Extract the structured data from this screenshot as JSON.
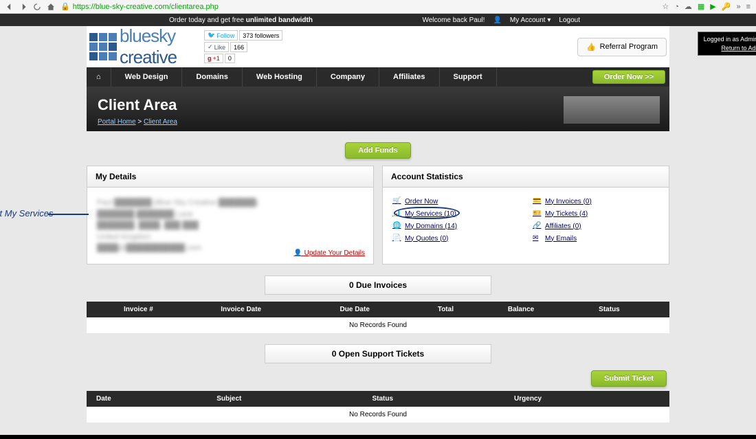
{
  "browser": {
    "url": "https://blue-sky-creative.com/clientarea.php"
  },
  "announce": {
    "left_pre": "Order today and get free ",
    "left_bold": "unlimited bandwidth",
    "welcome": "Welcome back Paul!",
    "my_account": "My Account",
    "logout": "Logout"
  },
  "admin_badge": {
    "line1": "Logged in as Administrator |",
    "line2": "Return to Admin Area"
  },
  "logo": {
    "text1": "bluesky",
    "text2": "creative"
  },
  "social": {
    "follow": "Follow",
    "followers": "373 followers",
    "like": "Like",
    "like_count": "166",
    "gplus": "+1",
    "gplus_count": "0"
  },
  "referral": "Referral Program",
  "nav": {
    "home": "⌂",
    "items": [
      "Web Design",
      "Domains",
      "Web Hosting",
      "Company",
      "Affiliates",
      "Support"
    ],
    "order": "Order Now >>"
  },
  "hero": {
    "title": "Client Area",
    "crumb_home": "Portal Home",
    "sep": " > ",
    "crumb_current": "Client Area"
  },
  "add_funds": "Add Funds",
  "panel1": {
    "title": "My Details",
    "blurred": "Paul ███████ (Blue Sky Creative ███████)\n███████ ███████ Lane\n███████, ████, ███ ███\nUnited Kingdom\n████@███████████.com",
    "update": "Update Your Details"
  },
  "panel2": {
    "title": "Account Statistics",
    "links": {
      "order": "Order Now",
      "services": "My Services (10)",
      "domains": "My Domains (14)",
      "quotes": "My Quotes (0)",
      "invoices": "My Invoices (0)",
      "tickets": "My Tickets (4)",
      "affiliates": "Affiliates (0)",
      "emails": "My Emails"
    }
  },
  "callout": "Select My Services",
  "invoices": {
    "title": "0 Due Invoices",
    "cols": [
      "",
      "Invoice #",
      "Invoice Date",
      "Due Date",
      "Total",
      "Balance",
      "Status"
    ],
    "empty": "No Records Found"
  },
  "tickets": {
    "title": "0 Open Support Tickets",
    "submit": "Submit Ticket",
    "cols": [
      "Date",
      "Subject",
      "Status",
      "Urgency"
    ],
    "empty": "No Records Found"
  }
}
